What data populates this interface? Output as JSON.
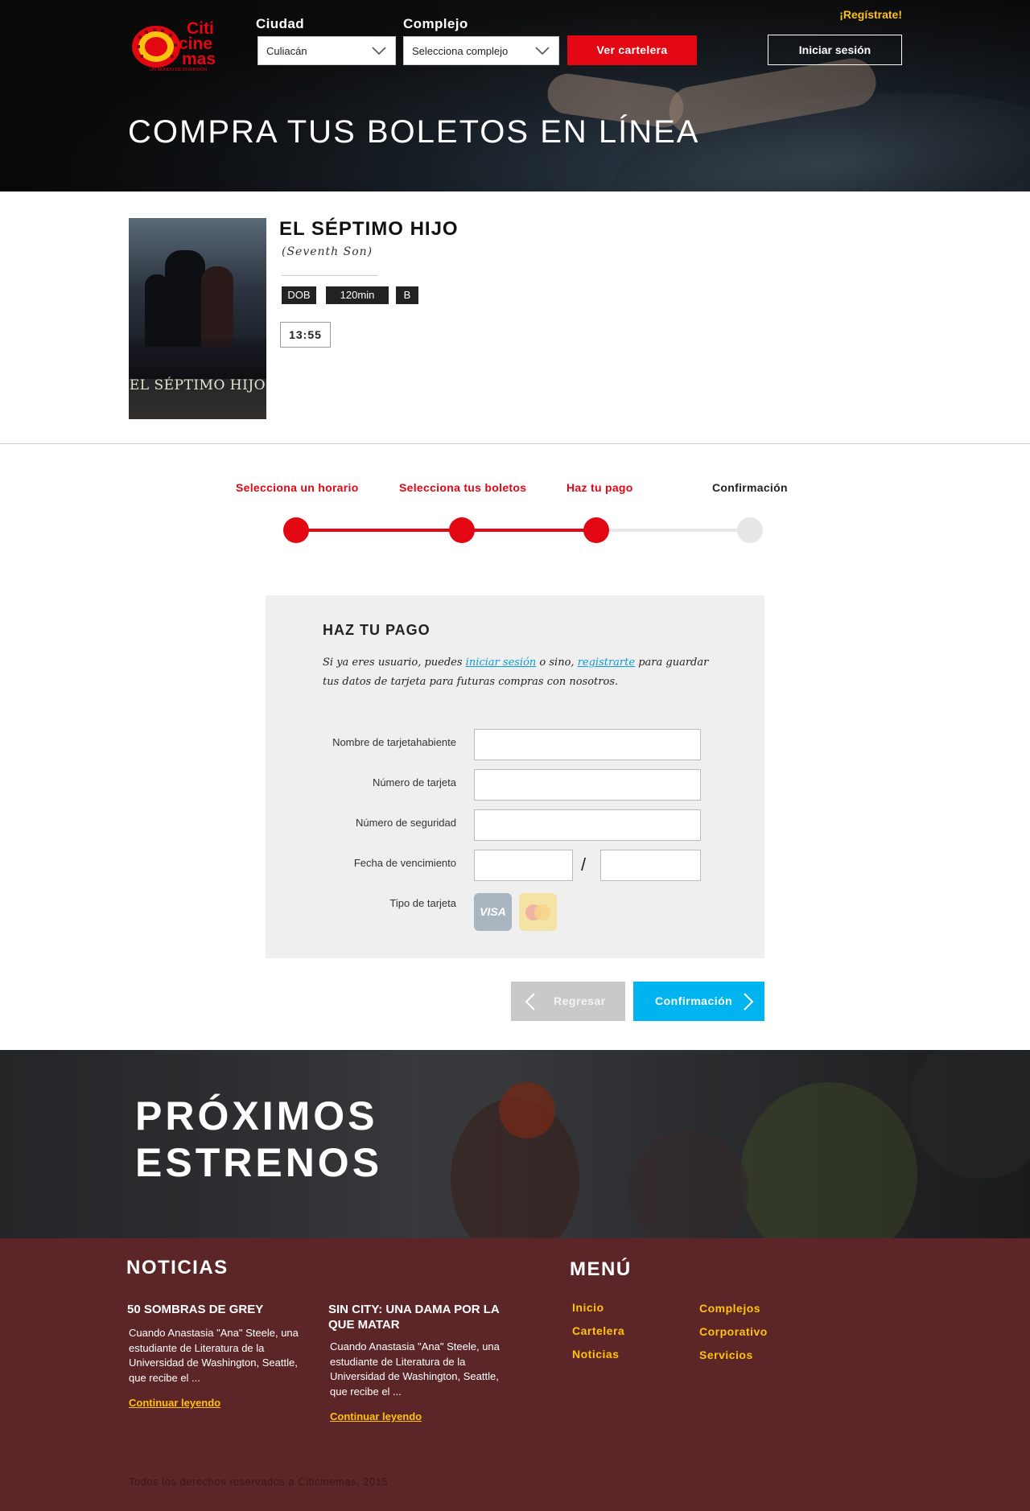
{
  "header": {
    "register_label": "¡Regístrate!",
    "city_label": "Ciudad",
    "city_value": "Culiacán",
    "complex_label": "Complejo",
    "complex_value": "Selecciona complejo",
    "cartelera_button": "Ver cartelera",
    "login_button": "Iniciar sesión",
    "brand_color": "#e30613",
    "accent_color": "#ffc20e"
  },
  "hero": {
    "title": "COMPRA TUS BOLETOS EN LÍNEA"
  },
  "movie": {
    "title": "EL SÉPTIMO HIJO",
    "original_title": "(Seventh Son)",
    "badges": [
      "DOB",
      "120min",
      "B"
    ],
    "showtime": "13:55",
    "poster_title": "EL SÉPTIMO HIJO"
  },
  "steps": [
    {
      "label": "Selecciona un horario",
      "done": true
    },
    {
      "label": "Selecciona tus boletos",
      "done": true
    },
    {
      "label": "Haz tu pago",
      "done": true
    },
    {
      "label": "Confirmación",
      "done": false
    }
  ],
  "payment": {
    "title": "HAZ TU PAGO",
    "intro_1": "Si ya eres usuario, puedes ",
    "login_link": "iniciar sesión",
    "intro_2": " o sino, ",
    "register_link": "registrarte",
    "intro_3": " para guardar tus datos de tarjeta para futuras compras con nosotros.",
    "fields": {
      "holder_label": "Nombre de tarjetahabiente",
      "holder_value": "",
      "number_label": "Número de tarjeta",
      "number_value": "",
      "cvv_label": "Número de seguridad",
      "cvv_value": "",
      "expiry_label": "Fecha de vencimiento",
      "expiry_separator": "/",
      "expiry_month": "",
      "expiry_year": "",
      "type_label": "Tipo de tarjeta"
    },
    "cards": [
      {
        "name": "VISA",
        "icon": "visa-icon"
      },
      {
        "name": "MasterCard",
        "icon": "mastercard-icon"
      }
    ],
    "back_button": "Regresar",
    "next_button": "Confirmación"
  },
  "upcoming": {
    "title": "PRÓXIMOS ESTRENOS"
  },
  "footer": {
    "news_heading": "NOTICIAS",
    "news": [
      {
        "title": "50 SOMBRAS DE GREY",
        "body": "Cuando Anastasia \"Ana\" Steele, una estudiante de Literatura de la Universidad de Washington, Seattle, que recibe el ...",
        "link": "Continuar leyendo"
      },
      {
        "title": "SIN CITY: UNA DAMA POR LA QUE MATAR",
        "body": "Cuando Anastasia \"Ana\" Steele, una estudiante de Literatura de la Universidad de Washington, Seattle, que recibe el ...",
        "link": "Continuar leyendo"
      }
    ],
    "menu_heading": "MENÚ",
    "menu_col1": [
      "Inicio",
      "Cartelera",
      "Noticias"
    ],
    "menu_col2": [
      "Complejos",
      "Corporativo",
      "Servicios"
    ],
    "copyright": "Todos los derechos reservados a Citicinemas, 2015"
  }
}
